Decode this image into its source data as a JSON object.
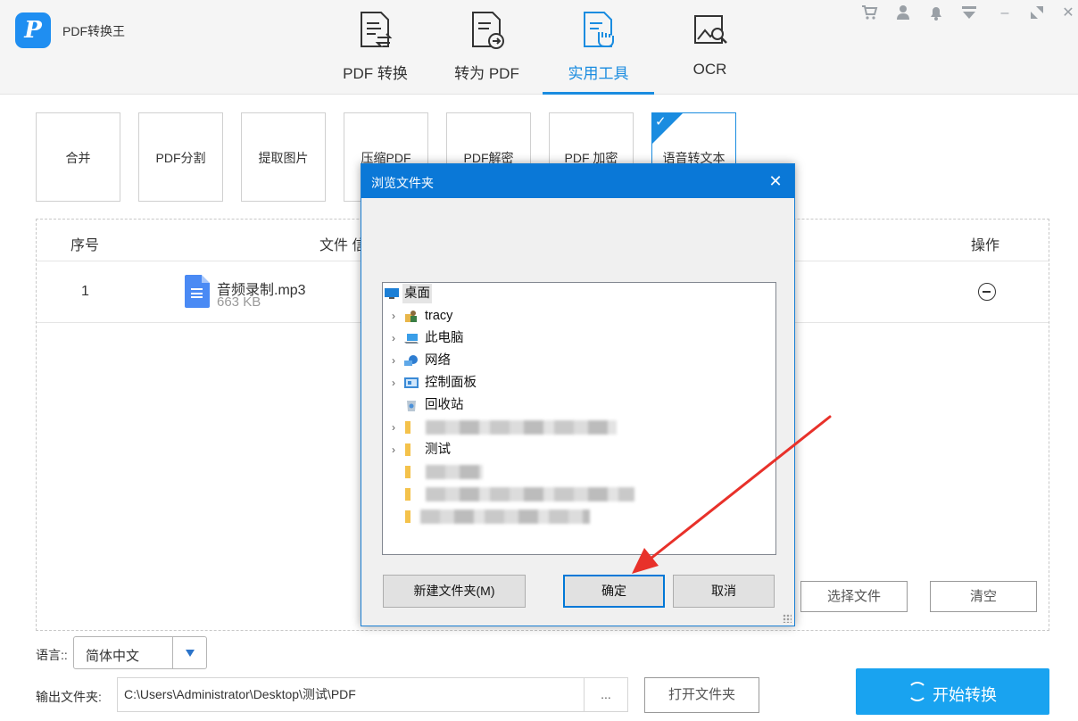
{
  "app": {
    "title": "PDF转换王",
    "logo_letter": "P"
  },
  "nav_tabs": [
    {
      "label": "PDF 转换",
      "icon": "document-convert-icon",
      "active": false
    },
    {
      "label": "转为 PDF",
      "icon": "document-export-icon",
      "active": false
    },
    {
      "label": "实用工具",
      "icon": "document-tools-icon",
      "active": true
    },
    {
      "label": "OCR",
      "icon": "image-search-icon",
      "active": false
    }
  ],
  "window_controls": {
    "cart": "🛒",
    "user": "●",
    "bell": "🔔",
    "menu": "☰",
    "minimize": "–",
    "restore": "⤡",
    "close": "✕"
  },
  "tools": [
    {
      "label": "合并",
      "active": false
    },
    {
      "label": "PDF分割",
      "active": false
    },
    {
      "label": "提取图片",
      "active": false
    },
    {
      "label": "压缩PDF",
      "active": false
    },
    {
      "label": "PDF解密",
      "active": false
    },
    {
      "label": "PDF 加密",
      "active": false
    },
    {
      "label": "语音转文本",
      "active": true
    }
  ],
  "file_table": {
    "headers": {
      "index": "序号",
      "name": "文件 信",
      "action": "操作"
    },
    "rows": [
      {
        "index": "1",
        "name": "音频录制.mp3",
        "size": "663 KB"
      }
    ],
    "select_files_label": "选择文件",
    "clear_label": "清空"
  },
  "language": {
    "label": "语言::",
    "value": "简体中文"
  },
  "output": {
    "label": "输出文件夹:",
    "path": "C:\\Users\\Administrator\\Desktop\\测试\\PDF",
    "more_label": "...",
    "open_folder_label": "打开文件夹"
  },
  "start_button": {
    "label": "开始转换"
  },
  "dialog": {
    "title": "浏览文件夹",
    "close_glyph": "✕",
    "tree": [
      {
        "label": "桌面",
        "expander": "",
        "icon": "desktop-icon",
        "selected": true
      },
      {
        "label": "tracy",
        "expander": "›",
        "icon": "user-folder-icon",
        "selected": false
      },
      {
        "label": "此电脑",
        "expander": "›",
        "icon": "computer-icon",
        "selected": false
      },
      {
        "label": "网络",
        "expander": "›",
        "icon": "network-icon",
        "selected": false
      },
      {
        "label": "控制面板",
        "expander": "›",
        "icon": "control-panel-icon",
        "selected": false
      },
      {
        "label": "回收站",
        "expander": "",
        "icon": "recycle-bin-icon",
        "selected": false
      },
      {
        "label": "",
        "expander": "›",
        "icon": "folder-icon",
        "selected": false
      },
      {
        "label": "测试",
        "expander": "›",
        "icon": "folder-icon",
        "selected": false
      },
      {
        "label": "",
        "expander": "",
        "icon": "folder-icon",
        "selected": false
      },
      {
        "label": "",
        "expander": "",
        "icon": "folder-icon",
        "selected": false
      },
      {
        "label": "",
        "expander": "",
        "icon": "folder-icon",
        "selected": false
      }
    ],
    "new_folder_label": "新建文件夹(M)",
    "ok_label": "确定",
    "cancel_label": "取消"
  },
  "colors": {
    "accent": "#1a8ce0",
    "start_button": "#19a3f0",
    "dialog_title": "#0a78d7",
    "annotation_arrow": "#e8312a"
  }
}
